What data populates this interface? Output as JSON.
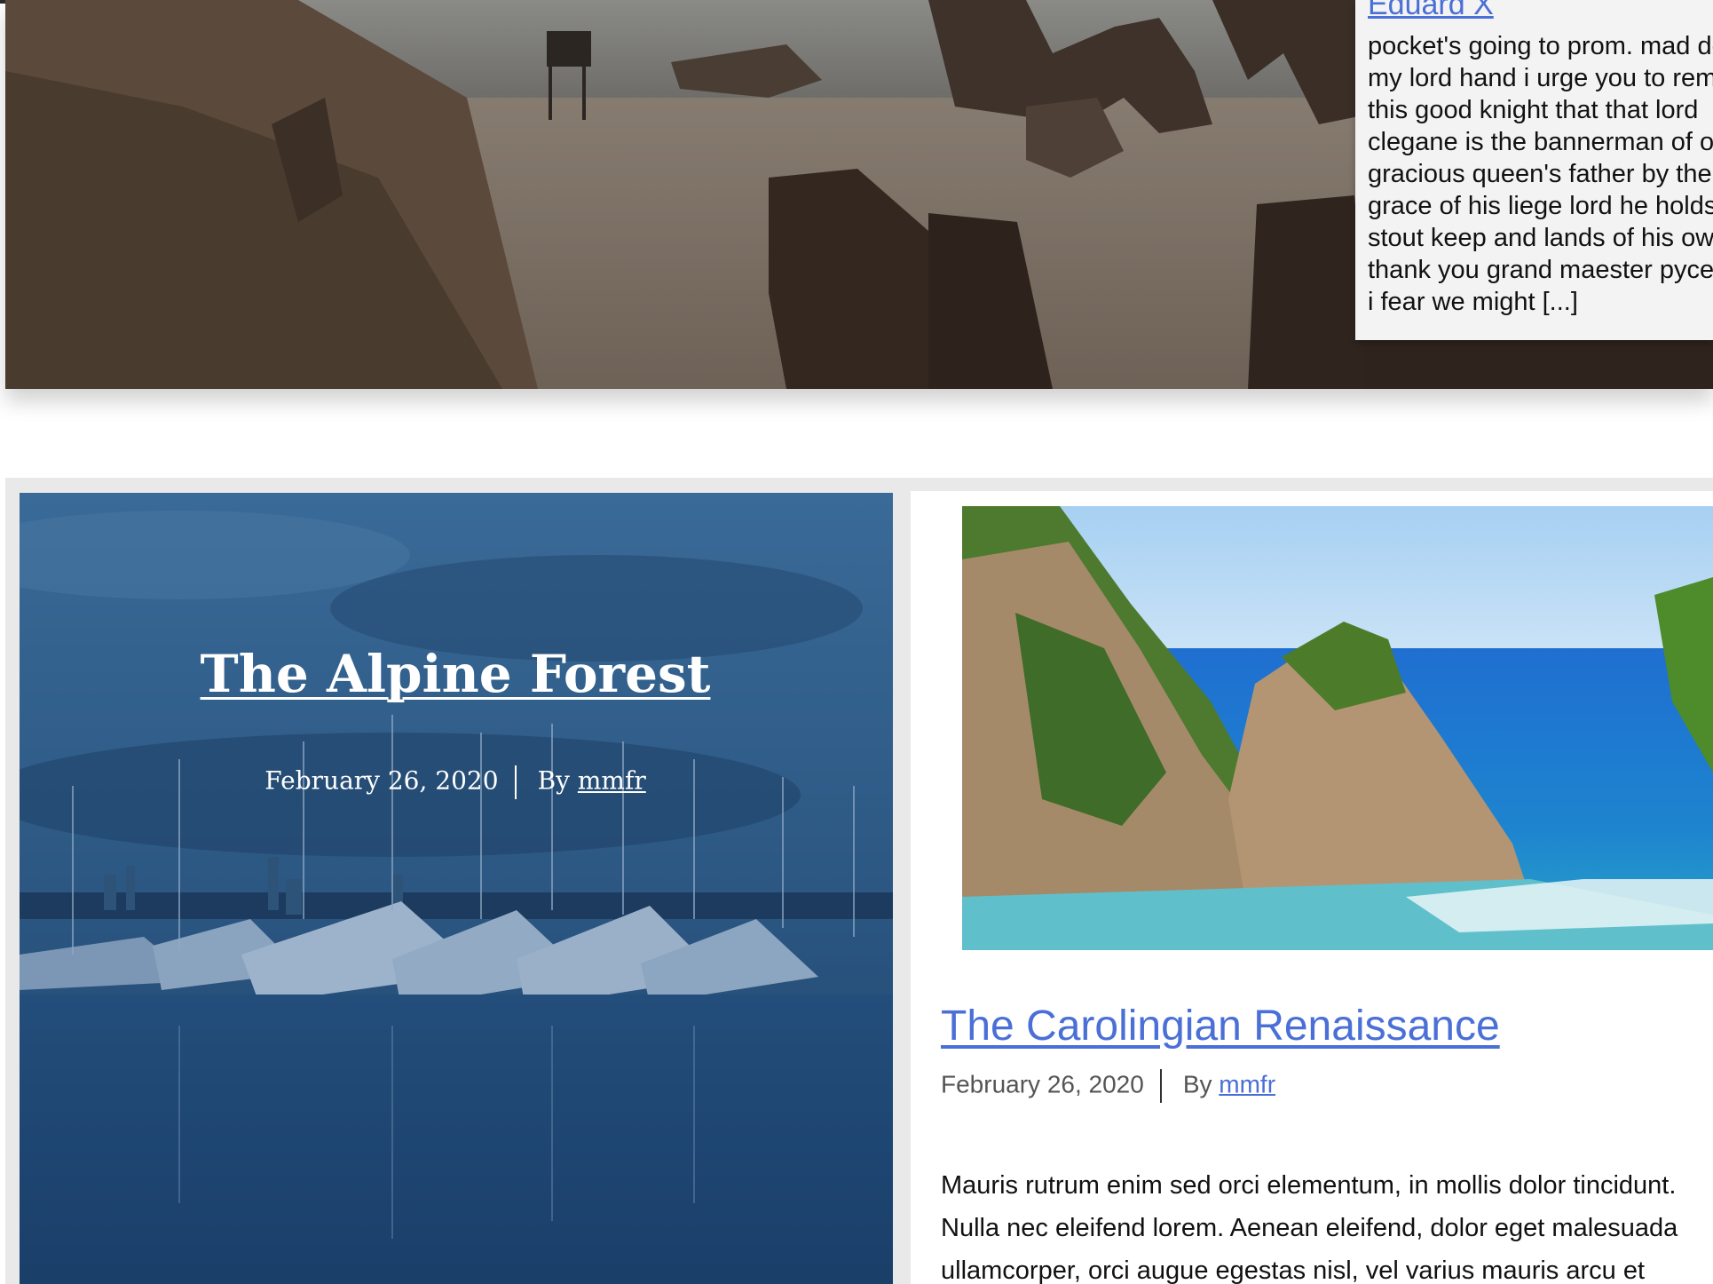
{
  "featured": {
    "author": "Eduard X",
    "excerpt": "pocket's going to prom. mad dog\nmy lord hand i urge you to remind\nthis good knight that that lord\nclegane is the bannerman of our\ngracious queen's father by the\ngrace of his liege lord he holds a\nstout keep and lands of his own\nthank you grand maester pycelle\ni fear we might [...]"
  },
  "posts": [
    {
      "title": "The Alpine Forest",
      "date": "February 26, 2020",
      "by": "By",
      "author": "mmfr"
    },
    {
      "title": "The Carolingian Renaissance",
      "date": "February 26, 2020",
      "by": "By",
      "author": "mmfr",
      "excerpt": "Mauris rutrum enim sed orci elementum, in mollis dolor tincidunt.\nNulla nec eleifend lorem. Aenean eleifend, dolor eget malesuada\nullamcorper, orci augue egestas nisl, vel varius mauris arcu et"
    }
  ],
  "colors": {
    "link": "#4a6fd6",
    "overlay": "#1d4f86",
    "grid_background": "#e9e9e9"
  }
}
